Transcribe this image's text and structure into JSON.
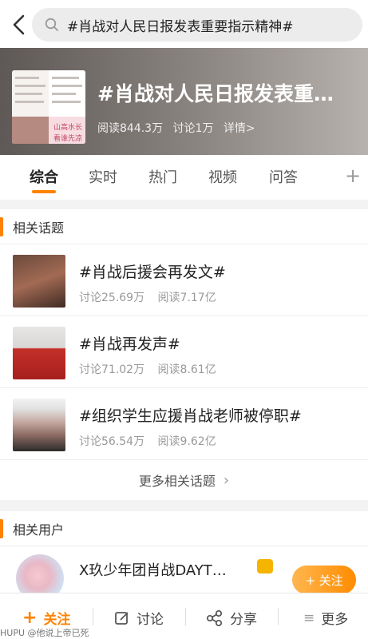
{
  "search": {
    "query": "#肖战对人民日报发表重要指示精神#"
  },
  "topic": {
    "title": "#肖战对人民日报发表重…",
    "reads": "阅读844.3万",
    "discussions": "讨论1万",
    "details": "详情>",
    "thumb_text": [
      "山高水长",
      "看谁先凉"
    ]
  },
  "tabs": [
    "综合",
    "实时",
    "热门",
    "视频",
    "问答"
  ],
  "related_topics": {
    "header": "相关话题",
    "items": [
      {
        "name": "#肖战后援会再发文#",
        "discuss": "讨论25.69万",
        "read": "阅读7.17亿"
      },
      {
        "name": "#肖战再发声#",
        "discuss": "讨论71.02万",
        "read": "阅读8.61亿"
      },
      {
        "name": "#组织学生应援肖战老师被停职#",
        "discuss": "讨论56.54万",
        "read": "阅读9.62亿"
      }
    ],
    "more": "更多相关话题"
  },
  "related_users": {
    "header": "相关用户",
    "items": [
      {
        "name": "X玖少年团肖战DAYT…",
        "follow": "+ 关注"
      }
    ]
  },
  "bottom_bar": {
    "follow": "关注",
    "comment": "讨论",
    "share": "分享",
    "more": "更多"
  },
  "watermark": "HUPU @他说上帝已死",
  "colors": {
    "accent": "#ff8200"
  }
}
